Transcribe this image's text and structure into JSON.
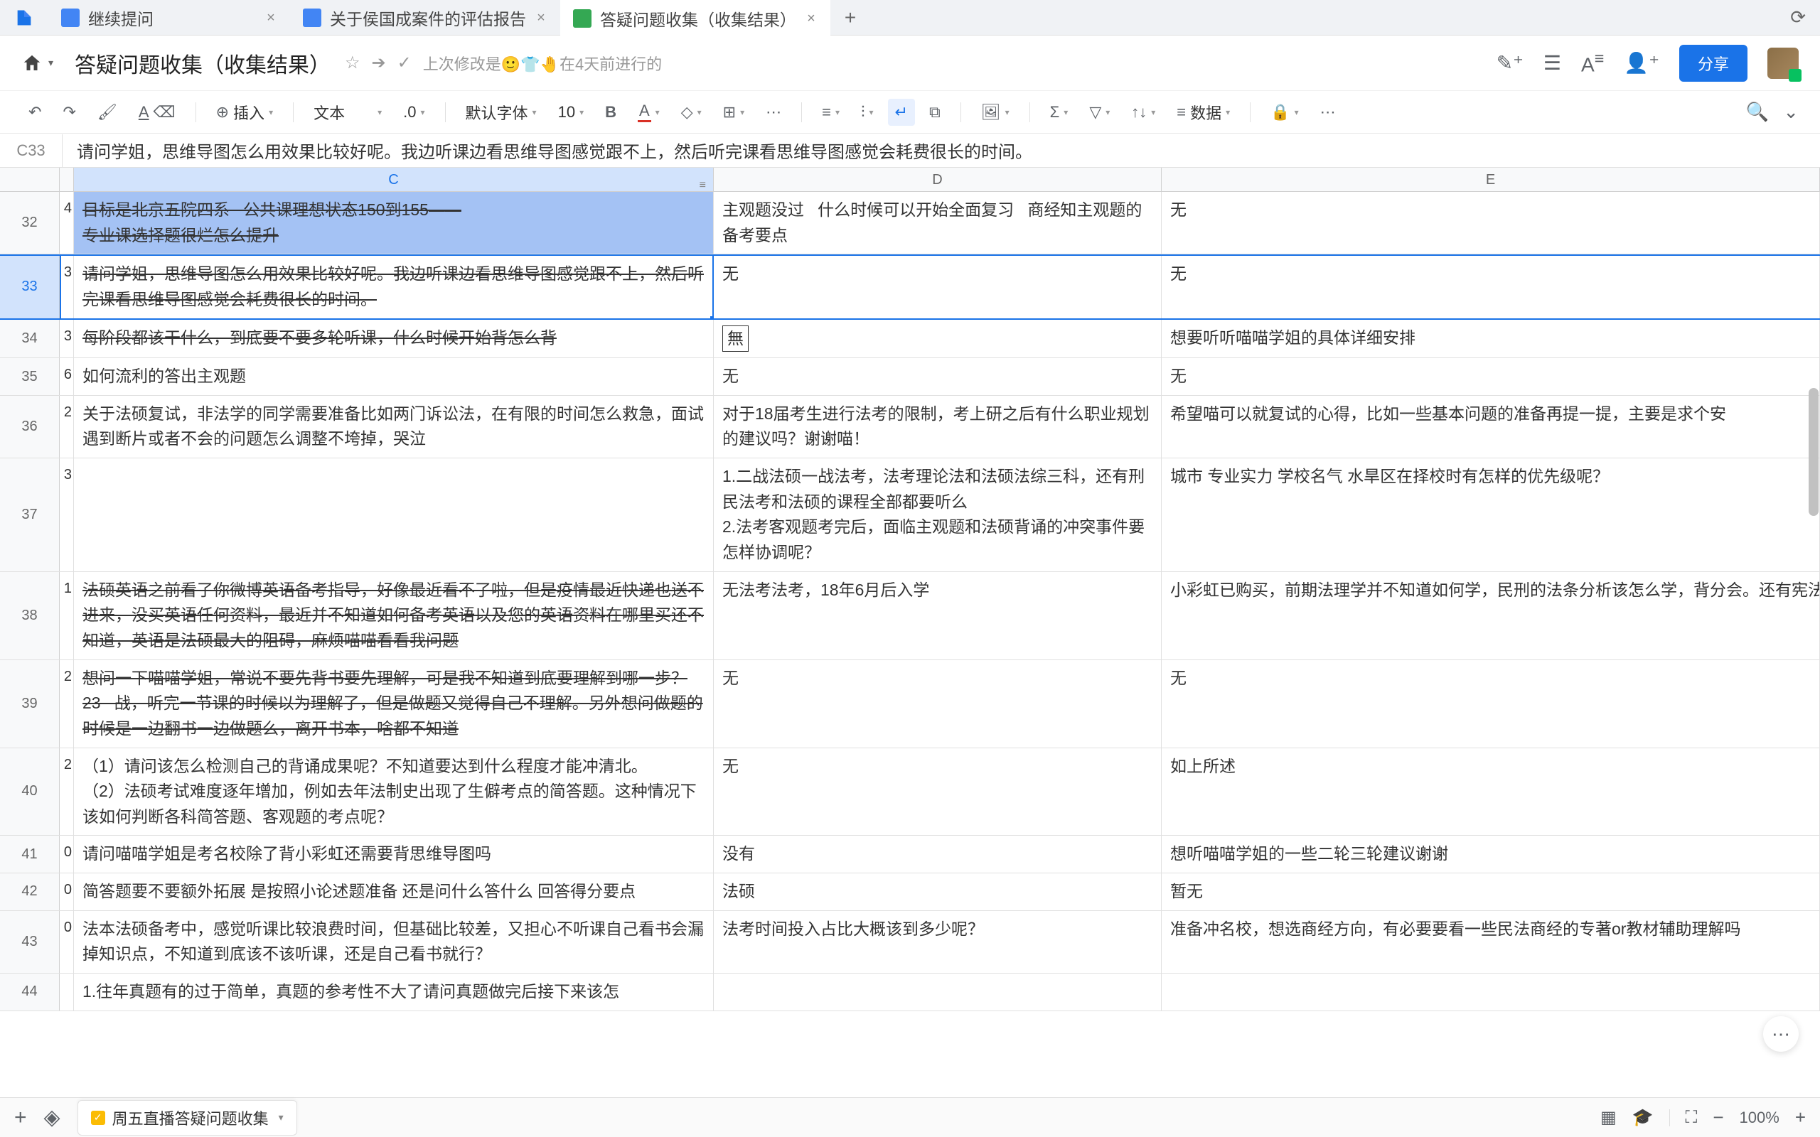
{
  "tabs": [
    {
      "icon": "doc",
      "title": "继续提问"
    },
    {
      "icon": "doc",
      "title": "关于侯国成案件的评估报告"
    },
    {
      "icon": "sheet",
      "title": "答疑问题收集（收集结果）"
    }
  ],
  "doc_title": "答疑问题收集（收集结果）",
  "last_edit": "上次修改是🙂👕🤚在4天前进行的",
  "share_label": "分享",
  "toolbar": {
    "insert": "插入",
    "format_type": "文本",
    "decimal": ".0",
    "font": "默认字体",
    "fontsize": "10",
    "data_label": "数据"
  },
  "cell_ref": "C33",
  "formula_value": "请问学姐，思维导图怎么用效果比较好呢。我边听课边看思维导图感觉跟不上，然后听完课看思维导图感觉会耗费很长的时间。",
  "col_headers": {
    "c": "C",
    "d": "D",
    "e": "E"
  },
  "rows": [
    {
      "n": 32,
      "b": "4",
      "c": "目标是北京五院四系   公共课理想状态150到155——\n专业课选择题很烂怎么提升",
      "c_strike": true,
      "d": "主观题没过   什么时候可以开始全面复习   商经知主观题的备考要点",
      "e": "无"
    },
    {
      "n": 33,
      "b": "3",
      "c": "请问学姐，思维导图怎么用效果比较好呢。我边听课边看思维导图感觉跟不上，然后听完课看思维导图感觉会耗费很长的时间。",
      "c_strike": true,
      "d": "无",
      "e": "无"
    },
    {
      "n": 34,
      "b": "3",
      "c": "每阶段都该干什么，到底要不要多轮听课，什么时候开始背怎么背",
      "c_strike": true,
      "d": "[無]",
      "d_boxed": true,
      "e": "想要听听喵喵学姐的具体详细安排"
    },
    {
      "n": 35,
      "b": "6",
      "c": "如何流利的答出主观题",
      "d": "无",
      "e": "无"
    },
    {
      "n": 36,
      "b": "2",
      "c": "关于法硕复试，非法学的同学需要准备比如两门诉讼法，在有限的时间怎么救急，面试遇到断片或者不会的问题怎么调整不垮掉，哭泣",
      "d": "对于18届考生进行法考的限制，考上研之后有什么职业规划的建议吗？谢谢喵！",
      "e": "希望喵可以就复试的心得，比如一些基本问题的准备再提一提，主要是求个安"
    },
    {
      "n": 37,
      "b": "3",
      "c": "",
      "d": "1.二战法硕一战法考，法考理论法和法硕法综三科，还有刑民法考和法硕的课程全部都要听么\n2.法考客观题考完后，面临主观题和法硕背诵的冲突事件要怎样协调呢？",
      "e": "城市 专业实力 学校名气 水旱区在择校时有怎样的优先级呢？"
    },
    {
      "n": 38,
      "b": "1",
      "c": "法硕英语之前看了你微博英语备考指导，好像最近看不了啦，但是疫情最近快递也送不进来，没买英语任何资料，最近并不知道如何备考英语以及您的英语资料在哪里买还不知道，英语是法硕最大的阻碍，麻烦喵喵看看我问题",
      "c_strike": true,
      "d": "无法考法考，18年6月后入学",
      "e": "小彩虹已购买，前期法理学并不知道如何学，民刑的法条分析该怎么学，背分会。还有宪法学要不要背宪法"
    },
    {
      "n": 39,
      "b": "2",
      "c": "想问一下喵喵学姐，常说不要先背书要先理解，可是我不知道到底要理解到哪一步？23   战，听完一节课的时候以为理解了，但是做题又觉得自己不理解。另外想问做题的时候是一边翻书一边做题么，离开书本，啥都不知道",
      "c_strike": true,
      "d": "无",
      "e": "无"
    },
    {
      "n": 40,
      "b": "2",
      "c": "（1）请问该怎么检测自己的背诵成果呢？不知道要达到什么程度才能冲清北。\n（2）法硕考试难度逐年增加，例如去年法制史出现了生僻考点的简答题。这种情况下该如何判断各科简答题、客观题的考点呢？",
      "d": "无",
      "e": "如上所述"
    },
    {
      "n": 41,
      "b": "0",
      "c": "请问喵喵学姐是考名校除了背小彩虹还需要背思维导图吗",
      "d": "没有",
      "e": "想听喵喵学姐的一些二轮三轮建议谢谢"
    },
    {
      "n": 42,
      "b": "0",
      "c": "简答题要不要额外拓展 是按照小论述题准备 还是问什么答什么 回答得分要点",
      "d": "法硕",
      "e": "暂无"
    },
    {
      "n": 43,
      "b": "0",
      "c": "法本法硕备考中，感觉听课比较浪费时间，但基础比较差，又担心不听课自己看书会漏掉知识点，不知道到底该不该听课，还是自己看书就行？",
      "d": "法考时间投入占比大概该到多少呢？",
      "e": "准备冲名校，想选商经方向，有必要要看一些民法商经的专著or教材辅助理解吗"
    },
    {
      "n": 44,
      "b": "",
      "c": "1.往年真题有的过于简单，真题的参考性不大了请问真题做完后接下来该怎",
      "d": "",
      "e": ""
    }
  ],
  "sheet_tab": "周五直播答疑问题收集",
  "zoom": "100%"
}
